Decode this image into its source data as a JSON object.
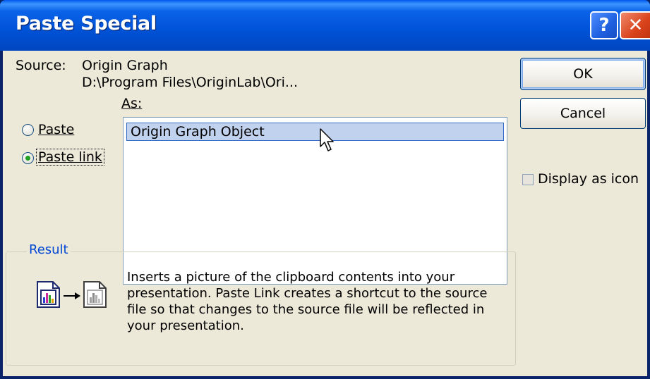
{
  "window": {
    "title": "Paste Special",
    "help_glyph": "?",
    "close_glyph": "✕"
  },
  "source": {
    "label": "Source:",
    "name": "Origin Graph",
    "path": "D:\\Program Files\\OriginLab\\Ori..."
  },
  "as_label": "As:",
  "options": {
    "paste": "Paste",
    "paste_link": "Paste link",
    "selected": "paste_link"
  },
  "list": {
    "items": [
      "Origin Graph Object"
    ],
    "selected_index": 0
  },
  "buttons": {
    "ok": "OK",
    "cancel": "Cancel"
  },
  "display_as_icon": {
    "label": "Display as icon",
    "checked": false
  },
  "result": {
    "label": "Result",
    "description": "Inserts a picture of the clipboard contents into your presentation. Paste Link creates a shortcut to the source file so that changes to the source file will be reflected in your presentation."
  },
  "colors": {
    "title_bar": "#0052d6",
    "dialog_bg": "#ece9d8",
    "result_label": "#0046d5",
    "selection": "#c1d2ee"
  },
  "icons": [
    "help-icon",
    "close-icon",
    "picture-icon",
    "arrow-icon",
    "link-picture-icon",
    "mouse-cursor-icon"
  ]
}
